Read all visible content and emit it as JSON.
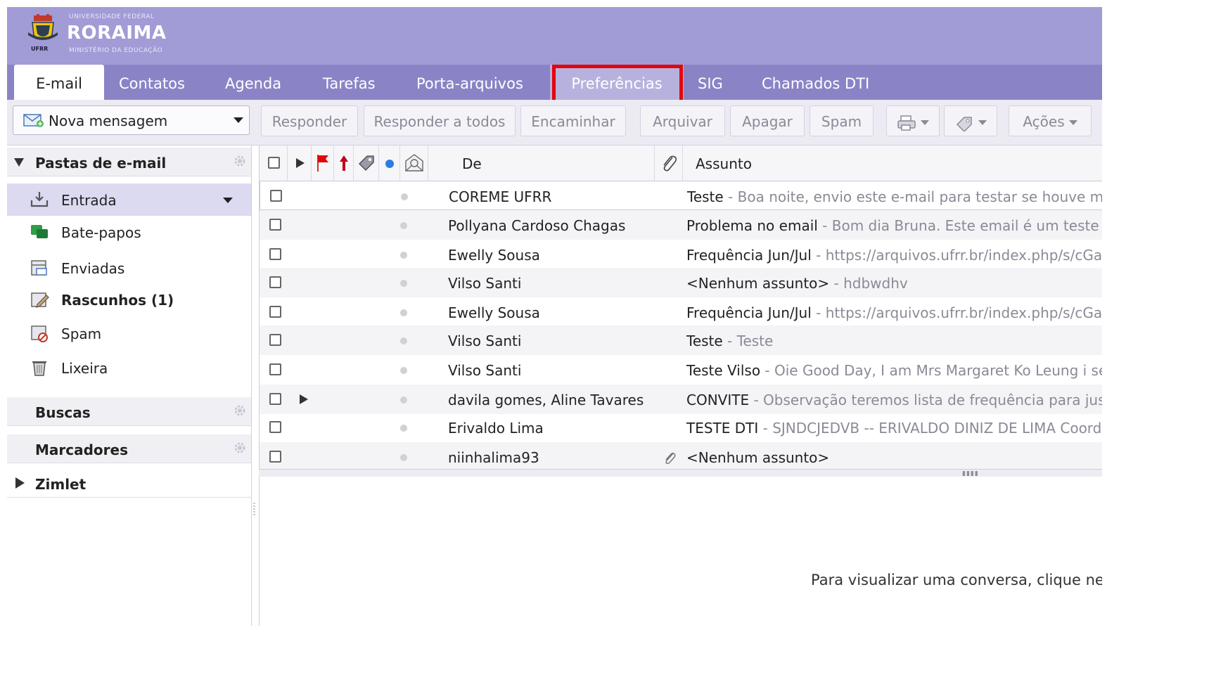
{
  "header": {
    "logo_top_text": "UNIVERSIDADE FEDERAL",
    "logo_title": "RORAIMA",
    "logo_bottom_text": "MINISTÉRIO DA EDUCAÇÃO",
    "emblem_label": "UFRR"
  },
  "tabs": [
    {
      "label": "E-mail",
      "active": true
    },
    {
      "label": "Contatos"
    },
    {
      "label": "Agenda"
    },
    {
      "label": "Tarefas"
    },
    {
      "label": "Porta-arquivos"
    },
    {
      "label": "Preferências",
      "highlighted": true
    },
    {
      "label": "SIG"
    },
    {
      "label": "Chamados DTI"
    }
  ],
  "toolbar": {
    "new_message": "Nova mensagem",
    "reply": "Responder",
    "reply_all": "Responder a todos",
    "forward": "Encaminhar",
    "archive": "Arquivar",
    "delete": "Apagar",
    "spam": "Spam",
    "actions": "Ações"
  },
  "sidebar": {
    "mail_folders_header": "Pastas de e-mail",
    "folders": [
      {
        "label": "Entrada",
        "icon": "inbox-icon",
        "selected": true
      },
      {
        "label": "Bate-papos",
        "icon": "chat-icon"
      },
      {
        "label": "Enviadas",
        "icon": "sent-icon"
      },
      {
        "label": "Rascunhos (1)",
        "icon": "drafts-icon",
        "bold": true
      },
      {
        "label": "Spam",
        "icon": "spam-icon"
      },
      {
        "label": "Lixeira",
        "icon": "trash-icon"
      }
    ],
    "searches_header": "Buscas",
    "tags_header": "Marcadores",
    "zimlet_header": "Zimlet"
  },
  "list": {
    "columns": {
      "from": "De",
      "subject": "Assunto"
    },
    "rows": [
      {
        "from": "COREME UFRR",
        "subject": "Teste",
        "fragment": " - Boa noite, envio este e-mail para testar se houve mudança"
      },
      {
        "from": "Pollyana Cardoso Chagas",
        "subject": "Problema no email",
        "fragment": " - Bom dia Bruna. Este email é um teste para"
      },
      {
        "from": "Ewelly Sousa",
        "subject": "Frequência Jun/Jul",
        "fragment": " - https://arquivos.ufrr.br/index.php/s/cGaY"
      },
      {
        "from": "Vilso Santi",
        "subject": "<Nenhum assunto>",
        "fragment": " - hdbwdhv"
      },
      {
        "from": "Ewelly Sousa",
        "subject": "Frequência Jun/Jul",
        "fragment": " - https://arquivos.ufrr.br/index.php/s/cGaY"
      },
      {
        "from": "Vilso Santi",
        "subject": "Teste",
        "fragment": " - Teste"
      },
      {
        "from": "Vilso Santi",
        "subject": "Teste Vilso",
        "fragment": " - Oie Good Day, I am Mrs Margaret Ko Leung i seek"
      },
      {
        "from": "davila gomes, Aline Tavares",
        "subject": "CONVITE",
        "fragment": " - Observação teremos lista de frequência para justificar",
        "expandable": true
      },
      {
        "from": "Erivaldo Lima",
        "subject": "TESTE DTI",
        "fragment": " - SJNDCJEDVB -- ERIVALDO DINIZ DE LIMA Coordenador"
      },
      {
        "from": "niinhalima93",
        "subject": "<Nenhum assunto>",
        "fragment": "",
        "attachment": true
      }
    ]
  },
  "reading_pane": {
    "message": "Para visualizar uma conversa, clique nela."
  },
  "colors": {
    "header": "#a19bd6",
    "tabbar": "#8a84c6",
    "highlight_box": "#e3050c",
    "selected_folder": "#dcdaf1"
  }
}
